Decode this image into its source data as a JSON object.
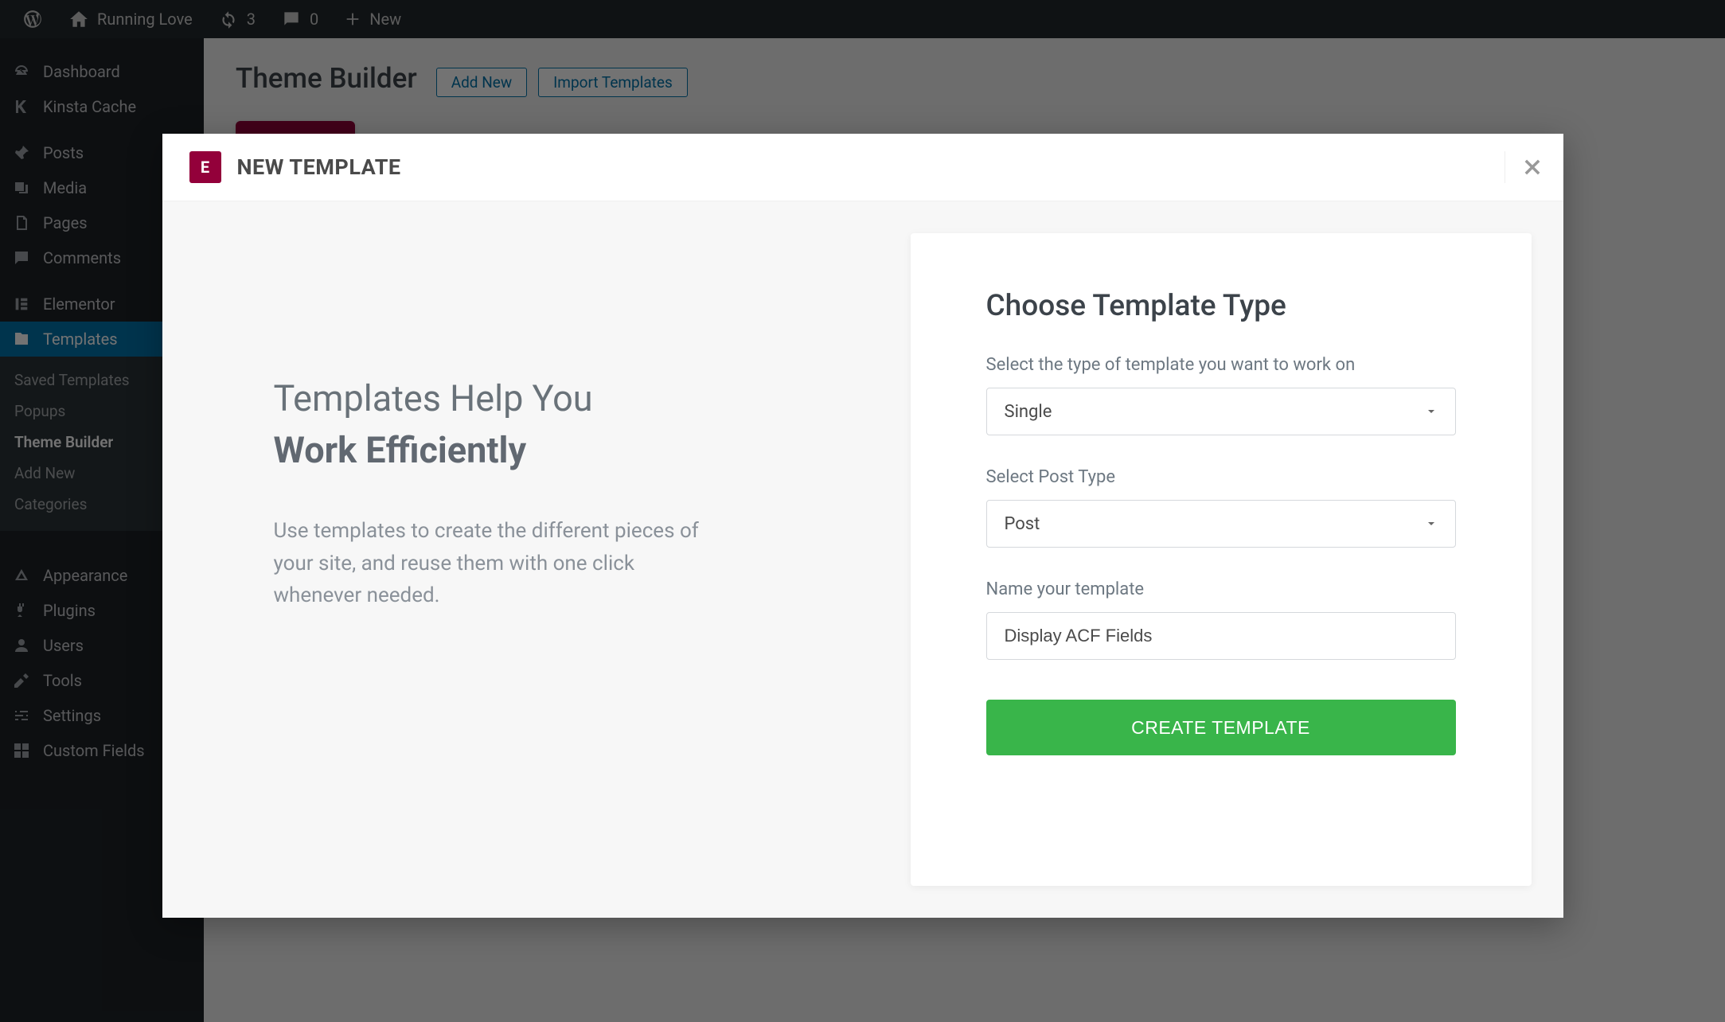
{
  "adminbar": {
    "site_name": "Running Love",
    "updates_count": "3",
    "comments_count": "0",
    "new_label": "New"
  },
  "sidebar": {
    "items": [
      {
        "label": "Dashboard",
        "icon": "dashboard-icon"
      },
      {
        "label": "Kinsta Cache",
        "icon": "kinsta-icon"
      },
      {
        "label": "Posts",
        "icon": "pin-icon"
      },
      {
        "label": "Media",
        "icon": "media-icon"
      },
      {
        "label": "Pages",
        "icon": "pages-icon"
      },
      {
        "label": "Comments",
        "icon": "comments-icon"
      },
      {
        "label": "Elementor",
        "icon": "elementor-icon"
      },
      {
        "label": "Templates",
        "icon": "templates-icon"
      },
      {
        "label": "Appearance",
        "icon": "appearance-icon"
      },
      {
        "label": "Plugins",
        "icon": "plugins-icon"
      },
      {
        "label": "Users",
        "icon": "users-icon"
      },
      {
        "label": "Tools",
        "icon": "tools-icon"
      },
      {
        "label": "Settings",
        "icon": "settings-icon"
      },
      {
        "label": "Custom Fields",
        "icon": "grid-icon"
      }
    ],
    "submenu": [
      {
        "label": "Saved Templates"
      },
      {
        "label": "Popups"
      },
      {
        "label": "Theme Builder"
      },
      {
        "label": "Add New"
      },
      {
        "label": "Categories"
      }
    ]
  },
  "content": {
    "page_title": "Theme Builder",
    "add_new": "Add New",
    "import": "Import Templates"
  },
  "modal": {
    "logo_text": "E",
    "title": "NEW TEMPLATE",
    "left": {
      "heading1": "Templates Help You",
      "heading2": "Work Efficiently",
      "desc": "Use templates to create the different pieces of your site, and reuse them with one click whenever needed."
    },
    "form": {
      "heading": "Choose Template Type",
      "type_label": "Select the type of template you want to work on",
      "type_value": "Single",
      "post_type_label": "Select Post Type",
      "post_type_value": "Post",
      "name_label": "Name your template",
      "name_value": "Display ACF Fields",
      "submit": "CREATE TEMPLATE"
    }
  }
}
